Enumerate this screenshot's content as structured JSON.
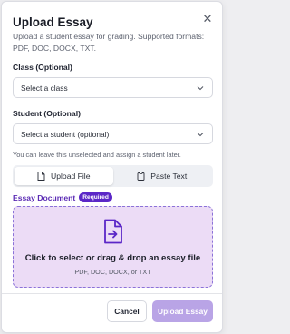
{
  "dialog": {
    "title": "Upload Essay",
    "description": "Upload a student essay for grading. Supported formats: PDF, DOC, DOCX, TXT.",
    "close_icon": "close-icon"
  },
  "class_field": {
    "label": "Class (Optional)",
    "value": "Select a class"
  },
  "student_field": {
    "label": "Student (Optional)",
    "value": "Select a student (optional)",
    "hint": "You can leave this unselected and assign a student later."
  },
  "tabs": [
    {
      "label": "Upload File",
      "icon": "file-icon",
      "active": true
    },
    {
      "label": "Paste Text",
      "icon": "clipboard-icon",
      "active": false
    }
  ],
  "document": {
    "label": "Essay Document",
    "badge": "Required",
    "dropzone_text": "Click to select or drag & drop an essay file",
    "dropzone_formats": "PDF, DOC, DOCX, or TXT",
    "icon": "file-upload-icon"
  },
  "actions": {
    "cancel_label": "Cancel",
    "upload_label": "Upload Essay"
  },
  "colors": {
    "accent": "#5b27c7",
    "dropzone_bg": "#ecdcf6",
    "upload_disabled": "#b9a4e6"
  }
}
